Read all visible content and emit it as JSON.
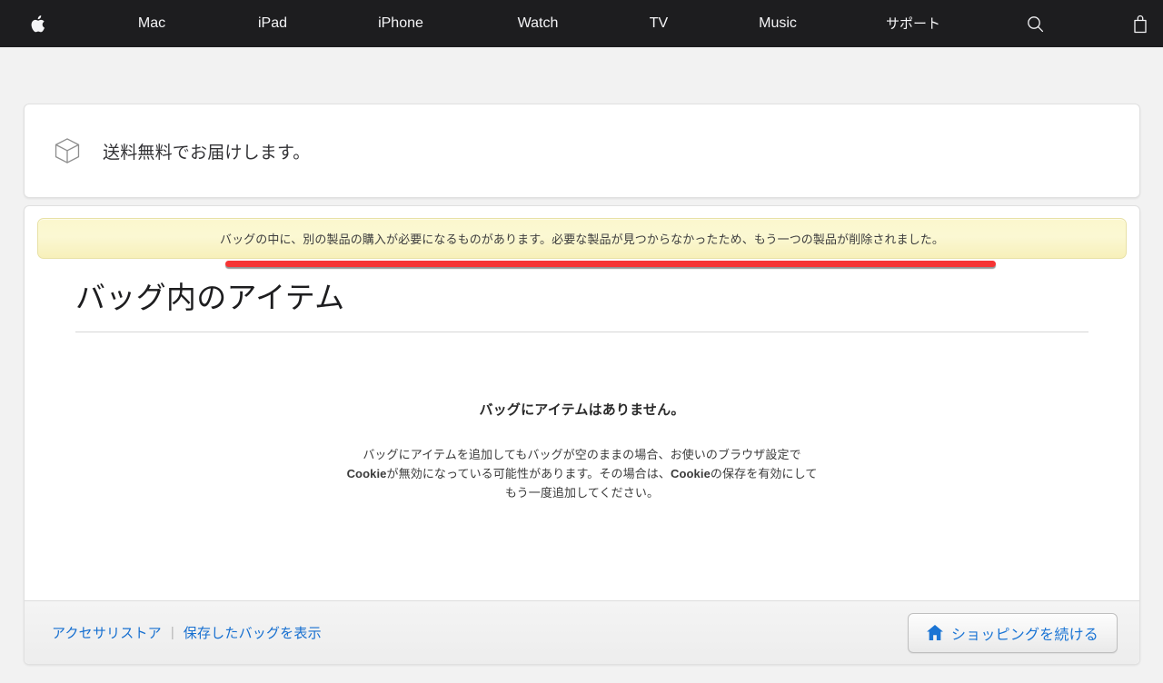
{
  "globalnav": {
    "items": [
      {
        "name": "apple-logo",
        "label": ""
      },
      {
        "name": "mac",
        "label": "Mac"
      },
      {
        "name": "ipad",
        "label": "iPad"
      },
      {
        "name": "iphone",
        "label": "iPhone"
      },
      {
        "name": "watch",
        "label": "Watch"
      },
      {
        "name": "tv",
        "label": "TV"
      },
      {
        "name": "music",
        "label": "Music"
      },
      {
        "name": "support",
        "label": "サポート"
      },
      {
        "name": "search",
        "label": ""
      },
      {
        "name": "bag",
        "label": ""
      }
    ],
    "mac": "Mac",
    "ipad": "iPad",
    "iphone": "iPhone",
    "watch": "Watch",
    "tv": "TV",
    "music": "Music",
    "support": "サポート",
    "background_color": "#1d1d1f"
  },
  "shipping": {
    "icon": "package-box-icon",
    "message": "送料無料でお届けします。"
  },
  "warning": {
    "message": "バッグの中に、別の製品の購入が必要になるものがあります。必要な製品が見つからなかったため、もう一つの製品が削除されました。",
    "background_color": "#fbf8d3",
    "annotation": {
      "type": "underline",
      "color": "#f63434"
    }
  },
  "bag": {
    "title": "バッグ内のアイテム",
    "empty_heading": "バッグにアイテムはありません。",
    "empty_body_line1": "バッグにアイテムを追加してもバッグが空のままの場合、お使いのブラウザ設定で",
    "empty_body_line2_a": "Cookie",
    "empty_body_line2_b": "が無効になっている可能性があります。その場合は、",
    "empty_body_line2_c": "Cookie",
    "empty_body_line2_d": "の保存を有効にして",
    "empty_body_line3": "もう一度追加してください。"
  },
  "footer": {
    "link_accessory_store": "アクセサリストア",
    "link_separator": "|",
    "link_saved_bags": "保存したバッグを表示",
    "continue_button": "ショッピングを続ける",
    "continue_icon": "home-icon",
    "link_color": "#166fd0"
  }
}
